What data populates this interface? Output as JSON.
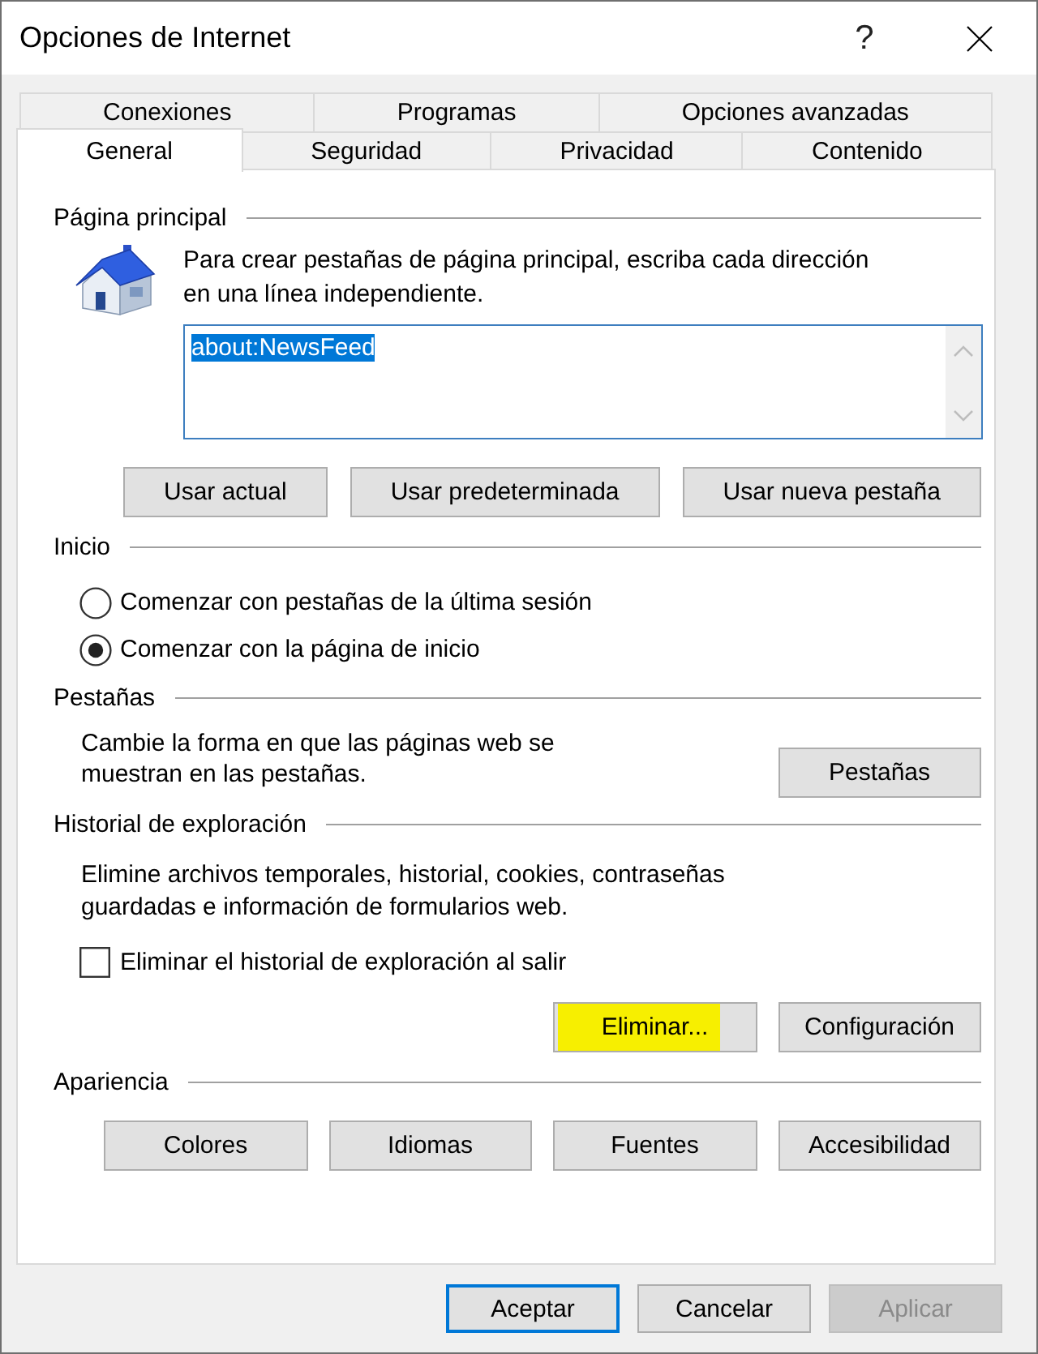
{
  "window": {
    "title": "Opciones de Internet",
    "help_button": "?"
  },
  "tab_rows": [
    {
      "tabs": [
        {
          "label": "Conexiones",
          "selected": false
        },
        {
          "label": "Programas",
          "selected": false
        },
        {
          "label": "Opciones avanzadas",
          "selected": false
        }
      ]
    },
    {
      "tabs": [
        {
          "label": "General",
          "selected": true
        },
        {
          "label": "Seguridad",
          "selected": false
        },
        {
          "label": "Privacidad",
          "selected": false
        },
        {
          "label": "Contenido",
          "selected": false
        }
      ]
    }
  ],
  "home_page": {
    "title": "Página principal",
    "description": "Para crear pestañas de página principal, escriba cada dirección\nen una línea independiente.",
    "value": "about:NewsFeed",
    "value_selected": true,
    "buttons": [
      "Usar actual",
      "Usar predeterminada",
      "Usar nueva pestaña"
    ]
  },
  "startup": {
    "title": "Inicio",
    "options": [
      {
        "label": "Comenzar con pestañas de la última sesión",
        "selected": false
      },
      {
        "label": "Comenzar con la página de inicio",
        "selected": true
      }
    ]
  },
  "tabs_section": {
    "title": "Pestañas",
    "description": "Cambie la forma en que las páginas web se\nmuestran en las pestañas.",
    "button": "Pestañas"
  },
  "history": {
    "title": "Historial de exploración",
    "description": "Elimine archivos temporales, historial, cookies, contraseñas\nguardadas e información de formularios web.",
    "checkbox": {
      "label": "Eliminar el historial de exploración al salir",
      "checked": false
    },
    "buttons": [
      {
        "label": "Eliminar...",
        "highlighted": true
      },
      {
        "label": "Configuración",
        "highlighted": false
      }
    ]
  },
  "appearance": {
    "title": "Apariencia",
    "buttons": [
      "Colores",
      "Idiomas",
      "Fuentes",
      "Accesibilidad"
    ]
  },
  "dialog_buttons": [
    {
      "label": "Aceptar",
      "default": true,
      "disabled": false
    },
    {
      "label": "Cancelar",
      "default": false,
      "disabled": false
    },
    {
      "label": "Aplicar",
      "default": false,
      "disabled": true
    }
  ]
}
